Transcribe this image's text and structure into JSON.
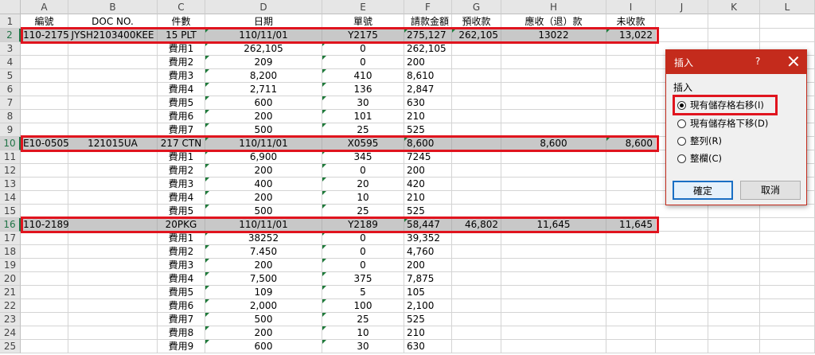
{
  "columns": [
    "A",
    "B",
    "C",
    "D",
    "E",
    "F",
    "G",
    "H",
    "I",
    "J",
    "K",
    "L"
  ],
  "header_row": {
    "A": "編號",
    "B": "DOC NO.",
    "C": "件數",
    "D": "日期",
    "E": "單號",
    "F": "請款金額",
    "G": "預收款",
    "H": "應收（退）款",
    "I": "未收款"
  },
  "rows": [
    {
      "n": "2",
      "A": "110-2175",
      "B": "JYSH2103400KEE",
      "C": "15 PLT",
      "D": "110/11/01",
      "E": "Y2175",
      "F": "275,127",
      "G": "262,105",
      "H": "13022",
      "I": "13,022"
    },
    {
      "n": "3",
      "C": "費用1",
      "D": "262,105",
      "E": "0",
      "F": "262,105"
    },
    {
      "n": "4",
      "C": "費用2",
      "D": "209",
      "E": "0",
      "F": "200"
    },
    {
      "n": "5",
      "C": "費用3",
      "D": "8,200",
      "E": "410",
      "F": "8,610"
    },
    {
      "n": "6",
      "C": "費用4",
      "D": "2,711",
      "E": "136",
      "F": "2,847"
    },
    {
      "n": "7",
      "C": "費用5",
      "D": "600",
      "E": "30",
      "F": "630"
    },
    {
      "n": "8",
      "C": "費用6",
      "D": "200",
      "E": "101",
      "F": "210"
    },
    {
      "n": "9",
      "C": "費用7",
      "D": "500",
      "E": "25",
      "F": "525"
    },
    {
      "n": "10",
      "A": "E10-0505",
      "B": "121015UA",
      "C": "217 CTN",
      "D": "110/11/01",
      "E": "X0595",
      "F": "8,600",
      "G": "",
      "H": "8,600",
      "I": "8,600"
    },
    {
      "n": "11",
      "C": "費用1",
      "D": "6,900",
      "E": "345",
      "F": "7245"
    },
    {
      "n": "12",
      "C": "費用2",
      "D": "200",
      "E": "0",
      "F": "200"
    },
    {
      "n": "13",
      "C": "費用3",
      "D": "400",
      "E": "20",
      "F": "420"
    },
    {
      "n": "14",
      "C": "費用4",
      "D": "200",
      "E": "10",
      "F": "210"
    },
    {
      "n": "15",
      "C": "費用5",
      "D": "500",
      "E": "25",
      "F": "525"
    },
    {
      "n": "16",
      "A": "110-2189",
      "B": "",
      "C": "20PKG",
      "D": "110/11/01",
      "E": "Y2189",
      "F": "58,447",
      "G": "46,802",
      "H": "11,645",
      "I": "11,645"
    },
    {
      "n": "17",
      "C": "費用1",
      "D": "38252",
      "E": "0",
      "F": "39,352"
    },
    {
      "n": "18",
      "C": "費用2",
      "D": "7.450",
      "E": "0",
      "F": "4,760"
    },
    {
      "n": "19",
      "C": "費用3",
      "D": "200",
      "E": "0",
      "F": "200"
    },
    {
      "n": "20",
      "C": "費用4",
      "D": "7,500",
      "E": "375",
      "F": "7,875"
    },
    {
      "n": "21",
      "C": "費用5",
      "D": "109",
      "E": "5",
      "F": "105"
    },
    {
      "n": "22",
      "C": "費用6",
      "D": "2,000",
      "E": "100",
      "F": "2,100"
    },
    {
      "n": "23",
      "C": "費用7",
      "D": "500",
      "E": "25",
      "F": "525"
    },
    {
      "n": "24",
      "C": "費用8",
      "D": "200",
      "E": "10",
      "F": "210"
    },
    {
      "n": "25",
      "C": "費用9",
      "D": "600",
      "E": "30",
      "F": "630"
    }
  ],
  "dialog": {
    "title": "插入",
    "help": "?",
    "group_label": "插入",
    "options": [
      {
        "label": "現有儲存格右移(I)",
        "selected": true
      },
      {
        "label": "現有儲存格下移(D)",
        "selected": false
      },
      {
        "label": "整列(R)",
        "selected": false
      },
      {
        "label": "整欄(C)",
        "selected": false
      }
    ],
    "ok_label": "確定",
    "cancel_label": "取消"
  },
  "colors": {
    "highlight_red": "#e0141e",
    "dialog_title_bg": "#c42b1c",
    "excel_green": "#217346",
    "gray_row": "#c8c8c8"
  }
}
